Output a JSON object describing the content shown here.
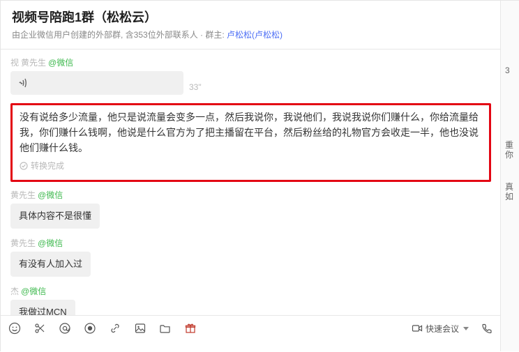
{
  "header": {
    "title": "视频号陪跑1群（松松云）",
    "subtitle_prefix": "由企业微信用户创建的外部群, 含",
    "member_count": "353",
    "subtitle_mid": "位外部联系人 · 群主: ",
    "owner_display": "卢松松(卢松松)"
  },
  "messages": {
    "m1": {
      "sender_prefix": "视",
      "sender_name": "黄先生",
      "wx_tag": "@微信",
      "voice_duration": "33\""
    },
    "transcript": {
      "text": "没有说给多少流量，他只是说流量会变多一点，然后我说你，我说他们，我说我说你们赚什么，你给流量给我，你们赚什么钱啊，他说是什么官方为了把主播留在平台，然后粉丝给的礼物官方会收走一半，他也没说他们赚什么钱。",
      "status": "转换完成"
    },
    "m2": {
      "sender_name": "黄先生",
      "wx_tag": "@微信",
      "text": "具体内容不是很懂"
    },
    "m3": {
      "sender_name": "黄先生",
      "wx_tag": "@微信",
      "text": "有没有人加入过"
    },
    "m4": {
      "sender_name": "杰",
      "wx_tag": "@微信",
      "text": "我做过MCN"
    }
  },
  "composer": {
    "quick_meeting_label": "快速会议",
    "input_value": ""
  },
  "right_panel": {
    "r1": "3",
    "r2": "重\n你",
    "r3": "真\n如"
  }
}
